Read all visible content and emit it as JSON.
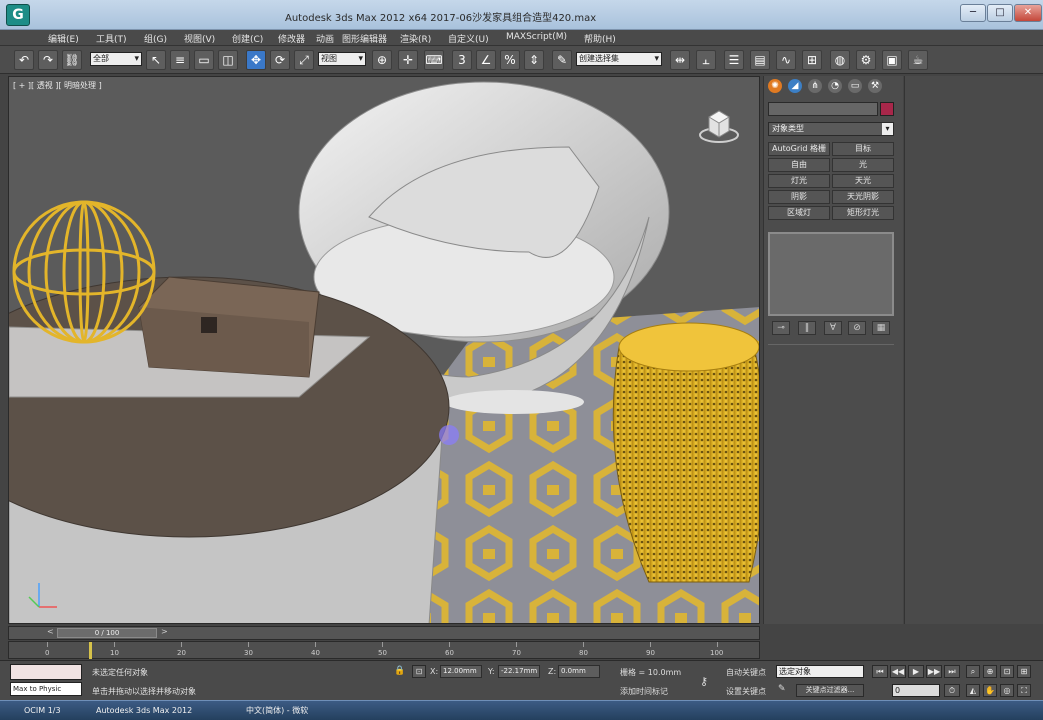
{
  "window": {
    "title": "Autodesk 3ds Max 2012 x64      2017-06沙发家具组合造型420.max",
    "minimize": "─",
    "maximize": "□",
    "close": "✕",
    "logo": "G"
  },
  "menu": {
    "items": [
      "编辑(E)",
      "工具(T)",
      "组(G)",
      "视图(V)",
      "创建(C)",
      "修改器",
      "动画",
      "图形编辑器",
      "渲染(R)",
      "自定义(U)",
      "MAXScript(M)",
      "帮助(H)"
    ]
  },
  "toolbar": {
    "filter_select": "全部",
    "refcoord_select": "视图",
    "named_selection": "创建选择集"
  },
  "viewport": {
    "label": "[ + ][ 透视 ][ 明暗处理 ]"
  },
  "command_panel": {
    "dropdown": "对象类型",
    "buttons": [
      "AutoGrid 格栅",
      "目标",
      "自由",
      "光",
      "灯光",
      "天光",
      "阴影",
      "天光阴影",
      "区域灯",
      "矩形灯光"
    ]
  },
  "timeslider": {
    "value": "0 / 100",
    "prev": "<",
    "next": ">"
  },
  "trackbar": {
    "ticks": [
      "0",
      "10",
      "20",
      "30",
      "40",
      "50",
      "60",
      "70",
      "80",
      "90",
      "100"
    ]
  },
  "status": {
    "maxscript": "Max to Physic",
    "prompt1": "未选定任何对象",
    "prompt2": "单击并拖动以选择并移动对象",
    "x_label": "X:",
    "x_value": "12.00mm",
    "y_label": "Y:",
    "y_value": "-22.17mm",
    "z_label": "Z:",
    "z_value": "0.0mm",
    "grid": "栅格 = 10.0mm",
    "timetag": "添加时间标记",
    "autokey_label": "自动关键点",
    "autokey_select": "选定对象",
    "setkey_label": "设置关键点",
    "keyfilter": "关键点过滤器...",
    "frame": "0"
  },
  "taskbar": {
    "items": [
      "OCIM 1/3",
      "Autodesk 3ds Max 2012",
      "中文(简体) - 微软"
    ]
  }
}
